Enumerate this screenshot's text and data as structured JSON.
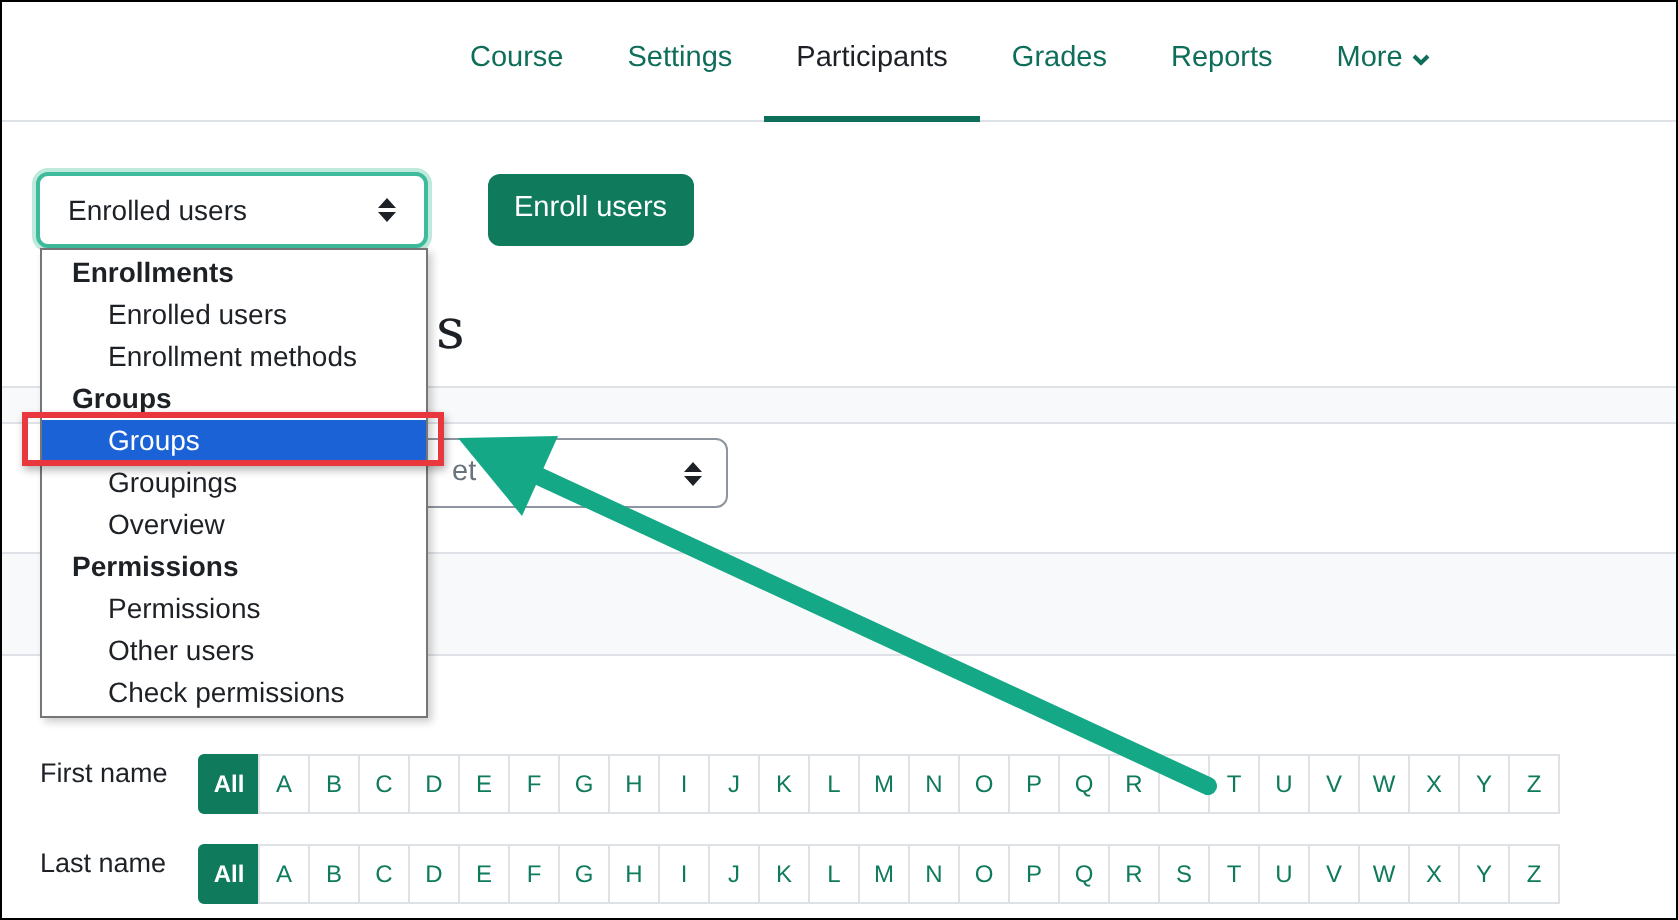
{
  "tabs": [
    {
      "label": "Course",
      "selected": false
    },
    {
      "label": "Settings",
      "selected": false
    },
    {
      "label": "Participants",
      "selected": true
    },
    {
      "label": "Grades",
      "selected": false
    },
    {
      "label": "Reports",
      "selected": false
    },
    {
      "label": "More",
      "selected": false,
      "kind": "menu"
    }
  ],
  "enrollment_select": {
    "value": "Enrolled users"
  },
  "enroll_button": "Enroll users",
  "page_heading": "s",
  "group_select": {
    "value": "et"
  },
  "dropdown": [
    {
      "kind": "header",
      "label": "Enrollments"
    },
    {
      "kind": "option",
      "label": "Enrolled users",
      "selected": false
    },
    {
      "kind": "option",
      "label": "Enrollment methods",
      "selected": false
    },
    {
      "kind": "header",
      "label": "Groups"
    },
    {
      "kind": "option",
      "label": "Groups",
      "selected": true
    },
    {
      "kind": "option",
      "label": "Groupings",
      "selected": false
    },
    {
      "kind": "option",
      "label": "Overview",
      "selected": false
    },
    {
      "kind": "header",
      "label": "Permissions"
    },
    {
      "kind": "option",
      "label": "Permissions",
      "selected": false
    },
    {
      "kind": "option",
      "label": "Other users",
      "selected": false
    },
    {
      "kind": "option",
      "label": "Check permissions",
      "selected": false
    }
  ],
  "initial_filters": [
    {
      "label": "First name",
      "letters": [
        {
          "kind": "letter",
          "label": "All",
          "selected": true
        },
        {
          "kind": "letter",
          "label": "A",
          "selected": false
        },
        {
          "kind": "letter",
          "label": "B",
          "selected": false
        },
        {
          "kind": "letter",
          "label": "C",
          "selected": false
        },
        {
          "kind": "letter",
          "label": "D",
          "selected": false
        },
        {
          "kind": "letter",
          "label": "E",
          "selected": false
        },
        {
          "kind": "letter",
          "label": "F",
          "selected": false
        },
        {
          "kind": "letter",
          "label": "G",
          "selected": false
        },
        {
          "kind": "letter",
          "label": "H",
          "selected": false
        },
        {
          "kind": "letter",
          "label": "I",
          "selected": false
        },
        {
          "kind": "letter",
          "label": "J",
          "selected": false
        },
        {
          "kind": "letter",
          "label": "K",
          "selected": false
        },
        {
          "kind": "letter",
          "label": "L",
          "selected": false
        },
        {
          "kind": "letter",
          "label": "M",
          "selected": false
        },
        {
          "kind": "letter",
          "label": "N",
          "selected": false
        },
        {
          "kind": "letter",
          "label": "O",
          "selected": false
        },
        {
          "kind": "letter",
          "label": "P",
          "selected": false
        },
        {
          "kind": "letter",
          "label": "Q",
          "selected": false
        },
        {
          "kind": "letter",
          "label": "R",
          "selected": false
        },
        {
          "kind": "covered"
        },
        {
          "kind": "letter",
          "label": "T",
          "selected": false
        },
        {
          "kind": "letter",
          "label": "U",
          "selected": false
        },
        {
          "kind": "letter",
          "label": "V",
          "selected": false
        },
        {
          "kind": "letter",
          "label": "W",
          "selected": false
        },
        {
          "kind": "letter",
          "label": "X",
          "selected": false
        },
        {
          "kind": "letter",
          "label": "Y",
          "selected": false
        },
        {
          "kind": "letter",
          "label": "Z",
          "selected": false
        }
      ]
    },
    {
      "label": "Last name",
      "letters": [
        {
          "kind": "letter",
          "label": "All",
          "selected": true
        },
        {
          "kind": "letter",
          "label": "A",
          "selected": false
        },
        {
          "kind": "letter",
          "label": "B",
          "selected": false
        },
        {
          "kind": "letter",
          "label": "C",
          "selected": false
        },
        {
          "kind": "letter",
          "label": "D",
          "selected": false
        },
        {
          "kind": "letter",
          "label": "E",
          "selected": false
        },
        {
          "kind": "letter",
          "label": "F",
          "selected": false
        },
        {
          "kind": "letter",
          "label": "G",
          "selected": false
        },
        {
          "kind": "letter",
          "label": "H",
          "selected": false
        },
        {
          "kind": "letter",
          "label": "I",
          "selected": false
        },
        {
          "kind": "letter",
          "label": "J",
          "selected": false
        },
        {
          "kind": "letter",
          "label": "K",
          "selected": false
        },
        {
          "kind": "letter",
          "label": "L",
          "selected": false
        },
        {
          "kind": "letter",
          "label": "M",
          "selected": false
        },
        {
          "kind": "letter",
          "label": "N",
          "selected": false
        },
        {
          "kind": "letter",
          "label": "O",
          "selected": false
        },
        {
          "kind": "letter",
          "label": "P",
          "selected": false
        },
        {
          "kind": "letter",
          "label": "Q",
          "selected": false
        },
        {
          "kind": "letter",
          "label": "R",
          "selected": false
        },
        {
          "kind": "letter",
          "label": "S",
          "selected": false
        },
        {
          "kind": "letter",
          "label": "T",
          "selected": false
        },
        {
          "kind": "letter",
          "label": "U",
          "selected": false
        },
        {
          "kind": "letter",
          "label": "V",
          "selected": false
        },
        {
          "kind": "letter",
          "label": "W",
          "selected": false
        },
        {
          "kind": "letter",
          "label": "X",
          "selected": false
        },
        {
          "kind": "letter",
          "label": "Y",
          "selected": false
        },
        {
          "kind": "letter",
          "label": "Z",
          "selected": false
        }
      ]
    }
  ]
}
